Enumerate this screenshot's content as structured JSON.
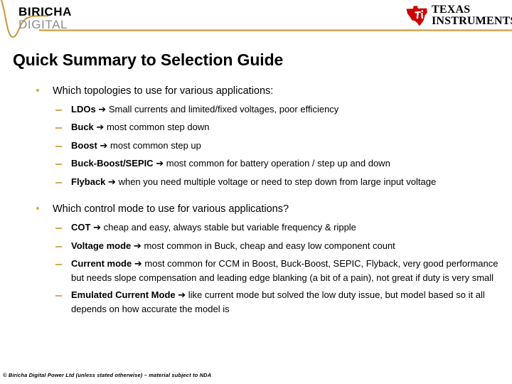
{
  "header": {
    "brand_line1": "BIRICHA",
    "brand_line2": "DIGITAL",
    "ti_line1": "TEXAS",
    "ti_line2": "INSTRUMENTS",
    "ti_mark_text": "ti",
    "rule_color": "#d9a441",
    "brand_gray": "#8c8c8c"
  },
  "title": "Quick Summary to Selection Guide",
  "colors": {
    "bullet_marker": "#d8a84e",
    "text": "#000000",
    "ti_red": "#cc0000"
  },
  "sections": [
    {
      "heading": "Which topologies to use for various applications:",
      "items": [
        {
          "bold": "LDOs",
          "arrow": "➔",
          "rest": "Small currents and limited/fixed voltages, poor efficiency"
        },
        {
          "bold": "Buck",
          "arrow": "➔",
          "rest": "most common step down"
        },
        {
          "bold": "Boost",
          "arrow": "➔",
          "rest": "most common step up"
        },
        {
          "bold": "Buck-Boost/SEPIC",
          "arrow": "➔",
          "rest": "most common for battery operation / step up and down"
        },
        {
          "bold": "Flyback",
          "arrow": "➔",
          "rest": "when you need multiple voltage or need to step down from large input voltage"
        }
      ]
    },
    {
      "heading": "Which control mode to use for various applications?",
      "items": [
        {
          "bold": "COT",
          "arrow": "➔",
          "rest": "cheap and easy, always stable but variable frequency & ripple"
        },
        {
          "bold": "Voltage mode",
          "arrow": "➔",
          "rest": "most common in Buck, cheap and easy low component count"
        },
        {
          "bold": "Current mode",
          "arrow": "➔",
          "rest": "most common for CCM in Boost, Buck-Boost, SEPIC, Flyback, very good performance but needs slope compensation and leading edge blanking (a bit of a pain), not great if duty is very small"
        },
        {
          "bold": "Emulated Current Mode",
          "arrow": "➔",
          "rest": "like current mode but solved the low duty issue, but model based so it all depends on how accurate the model is"
        }
      ]
    }
  ],
  "footer": "© Biricha Digital Power Ltd  (unless stated otherwise) – material subject to NDA"
}
